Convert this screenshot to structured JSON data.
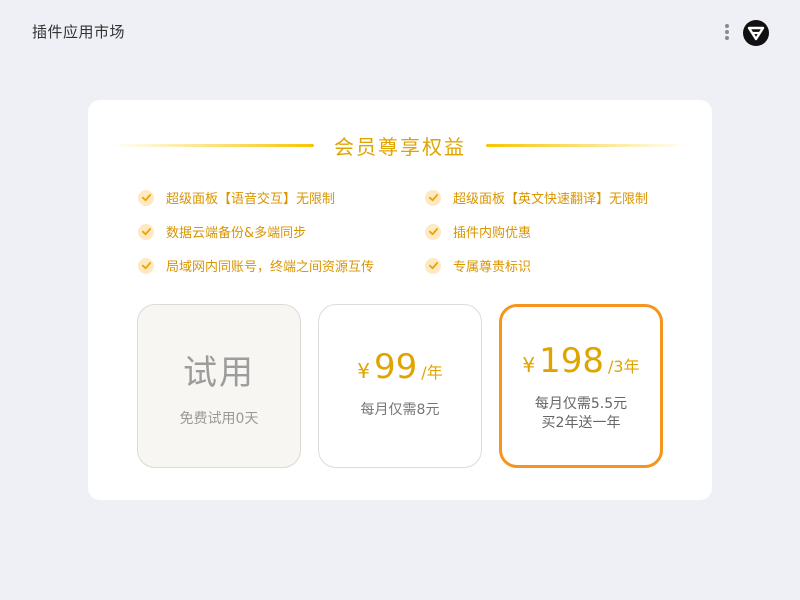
{
  "header": {
    "title": "插件应用市场",
    "logo_icon": "logo-icon",
    "more_icon": "more-vertical-icon"
  },
  "card": {
    "heading": "会员尊享权益",
    "benefits": [
      "超级面板【语音交互】无限制",
      "超级面板【英文快速翻译】无限制",
      "数据云端备份&多端同步",
      "插件内购优惠",
      "局域网内同账号，终端之间资源互传",
      "专属尊贵标识"
    ],
    "plans": {
      "trial": {
        "title": "试用",
        "subtitle": "免费试用0天"
      },
      "monthly": {
        "currency": "¥",
        "amount": "99",
        "period": "/年",
        "note": "每月仅需8元"
      },
      "triennial": {
        "currency": "¥",
        "amount": "198",
        "period": "/3年",
        "note_line1": "每月仅需5.5元",
        "note_line2": "买2年送一年",
        "selected": true
      }
    }
  },
  "colors": {
    "accent": "#e0a400",
    "selected_border": "#f5951f",
    "check_bg": "#fde9c2",
    "background": "#eef0f5"
  }
}
